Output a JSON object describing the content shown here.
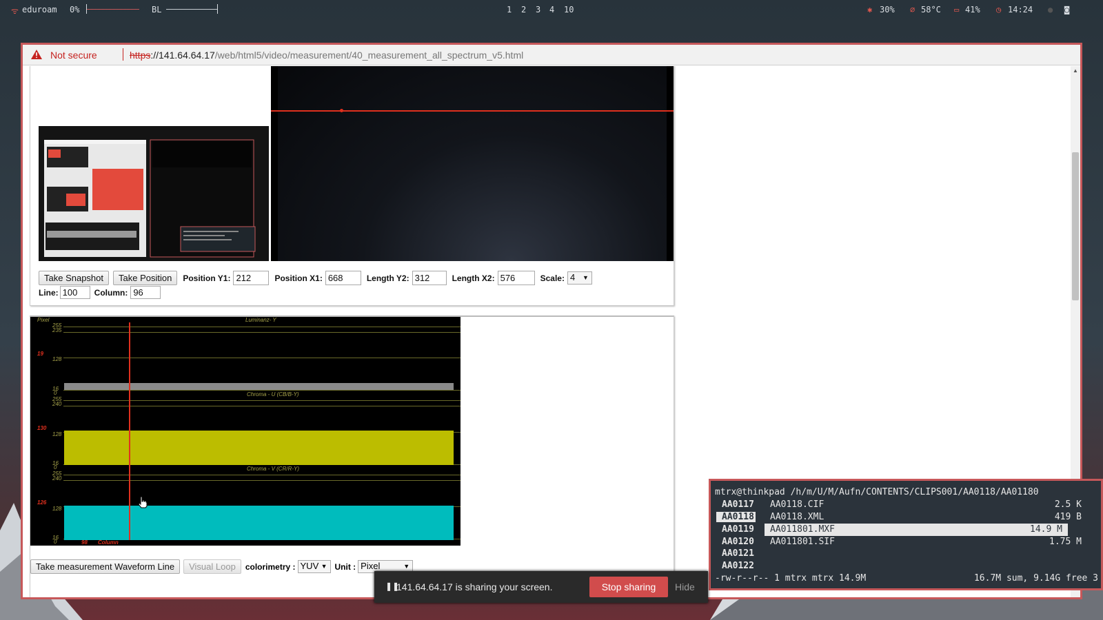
{
  "topbar": {
    "network": "eduroam",
    "volume": "0%",
    "brightness_label": "BL",
    "workspaces": [
      "1",
      "2",
      "3",
      "4",
      "10"
    ],
    "cpu": "30%",
    "temp": "58°C",
    "battery": "41%",
    "time": "14:24"
  },
  "browser": {
    "not_secure": "Not secure",
    "url_scheme": "https",
    "url_host": "://141.64.64.17",
    "url_path": "/web/html5/video/measurement/40_measurement_all_spectrum_v5.html"
  },
  "controls": {
    "take_snapshot": "Take Snapshot",
    "take_position": "Take Position",
    "position_y1_label": "Position Y1:",
    "position_y1": "212",
    "position_x1_label": "Position X1:",
    "position_x1": "668",
    "length_y2_label": "Length Y2:",
    "length_y2": "312",
    "length_x2_label": "Length X2:",
    "length_x2": "576",
    "scale_label": "Scale:",
    "scale": "4",
    "line_label": "Line:",
    "line": "100",
    "column_label": "Column:",
    "column": "96"
  },
  "waveform": {
    "axis_label": "Pixel",
    "luma_title": "Luminanz- Y",
    "u_title": "Chroma - U (CB/B-Y)",
    "v_title": "Chroma - V (CR/R-Y)",
    "luma_ticks": [
      "255",
      "235",
      "128",
      "16",
      "0"
    ],
    "u_ticks": [
      "255",
      "240",
      "128",
      "16",
      "0"
    ],
    "v_ticks": [
      "255",
      "240",
      "128",
      "16",
      "0"
    ],
    "luma_value": "19",
    "u_value": "130",
    "v_value": "126",
    "column_value": "98",
    "column_label": "Column"
  },
  "controls2": {
    "take_waveform": "Take measurement Waveform Line",
    "visual_loop": "Visual Loop",
    "colorimetry_label": "colorimetry :",
    "colorimetry": "YUV",
    "unit_label": "Unit :",
    "unit": "Pixel"
  },
  "terminal": {
    "path": "mtrx@thinkpad /h/m/U/M/Aufn/CONTENTS/CLIPS001/AA0118/AA01180",
    "dirs": [
      "AA0117",
      "AA0118",
      "AA0119",
      "AA0120",
      "AA0121",
      "AA0122"
    ],
    "files": [
      {
        "name": "AA0118.CIF",
        "size": "2.5 K"
      },
      {
        "name": "AA0118.XML",
        "size": "419 B"
      },
      {
        "name": "AA011801.MXF",
        "size": "14.9 M"
      },
      {
        "name": "AA011801.SIF",
        "size": "1.75 M"
      }
    ],
    "status_left": "-rw-r--r-- 1 mtrx mtrx 14.9M",
    "status_right": "16.7M sum, 9.14G free  3"
  },
  "share": {
    "message": "141.64.64.17 is sharing your screen.",
    "stop": "Stop sharing",
    "hide": "Hide"
  }
}
